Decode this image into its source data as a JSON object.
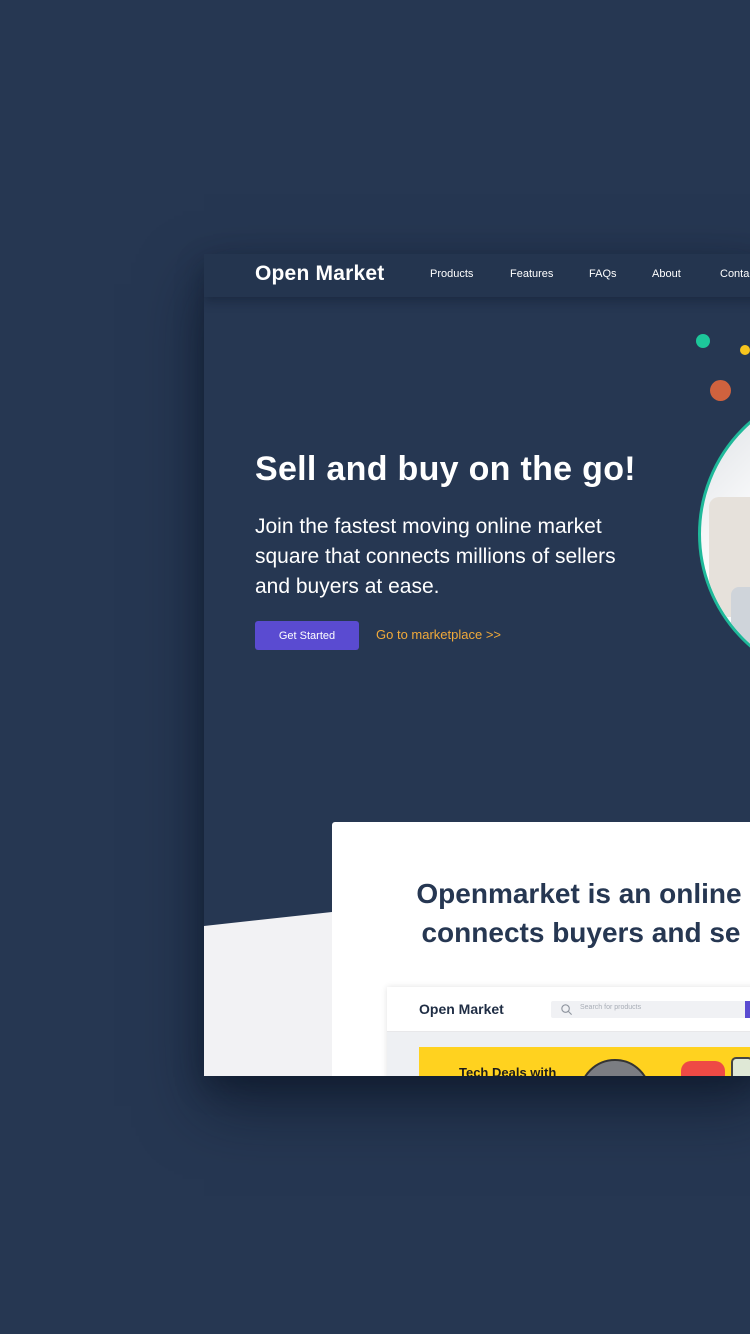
{
  "app": {
    "brand": "Open Market"
  },
  "nav": {
    "items": [
      {
        "label": "Products"
      },
      {
        "label": "Features"
      },
      {
        "label": "FAQs"
      },
      {
        "label": "About"
      },
      {
        "label": "Conta"
      }
    ]
  },
  "hero": {
    "title": "Sell and buy on the go!",
    "subtitle": "Join the fastest moving online market square that connects millions of sellers and buyers at ease.",
    "primary_button": "Get Started",
    "secondary_link": "Go to marketplace >>"
  },
  "section": {
    "heading_line1": "Openmarket is an online",
    "heading_line2": "connects buyers and se"
  },
  "preview": {
    "brand": "Open Market",
    "search_placeholder": "Search for products",
    "banner_text": "Tech Deals with"
  },
  "colors": {
    "background": "#263752",
    "accent": "#5a4bd1",
    "link": "#f0a93a",
    "ring": "#1fb99a",
    "dot_green": "#1dc79a",
    "dot_yellow": "#f7c51e",
    "dot_orange": "#d0623e",
    "banner": "#ffd21f"
  },
  "icons": {
    "search": "search-icon"
  }
}
